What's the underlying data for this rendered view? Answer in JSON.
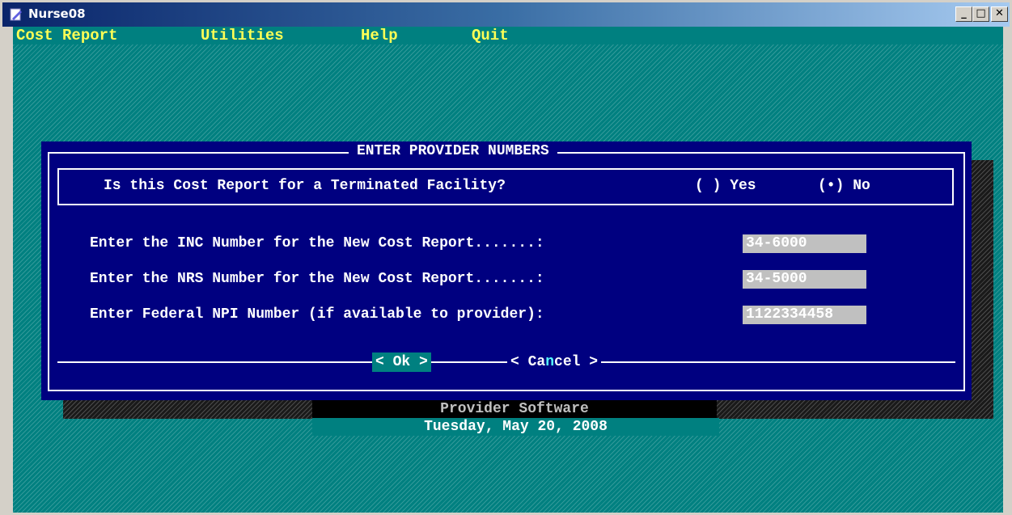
{
  "window": {
    "title": "Nurse08",
    "icon": "app-icon",
    "controls": [
      "minimize-icon",
      "maximize-icon",
      "close-icon"
    ]
  },
  "menu": [
    {
      "label": "Cost Report"
    },
    {
      "label": "Utilities"
    },
    {
      "label": "Help"
    },
    {
      "label": "Quit"
    }
  ],
  "dialog": {
    "title": "ENTER PROVIDER NUMBERS",
    "terminated_question": "Is this Cost Report for a Terminated Facility?",
    "radio_yes": "( ) Yes",
    "radio_no": "(•) No",
    "selected": "No",
    "inc_label": "Enter the INC Number for the New Cost Report.......:",
    "inc_value": "34-6000",
    "nrs_label": "Enter the NRS Number for the New Cost Report.......:",
    "nrs_value": "34-5000",
    "npi_label": "Enter Federal NPI Number (if available to provider):",
    "npi_value": "1122334458",
    "ok_label": "< Ok >",
    "cancel_prefix": "< Ca",
    "cancel_hotkey": "n",
    "cancel_suffix": "cel >"
  },
  "status": {
    "product": "Provider Software",
    "date": "Tuesday, May 20, 2008"
  },
  "colors": {
    "desktop": "#008080",
    "dialog_bg": "#000080",
    "menu_text": "#ffff55",
    "field_bg": "#c0c0c0"
  }
}
